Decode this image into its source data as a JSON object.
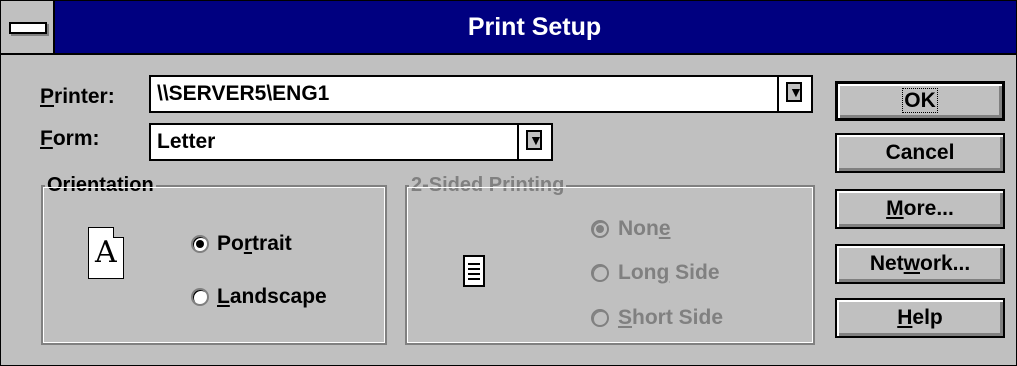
{
  "window": {
    "title": "Print Setup"
  },
  "printer": {
    "label_mnemonic": "P",
    "label_rest": "rinter:",
    "value": "\\\\SERVER5\\ENG1"
  },
  "form": {
    "label_mnemonic": "F",
    "label_rest": "orm:",
    "value": "Letter"
  },
  "orientation": {
    "title": "Orientation",
    "portrait": {
      "before": "Po",
      "mnemonic": "r",
      "after": "trait",
      "selected": true
    },
    "landscape": {
      "before": "",
      "mnemonic": "L",
      "after": "andscape",
      "selected": false
    },
    "icon_letter": "A"
  },
  "two_sided": {
    "title": "2-Sided Printing",
    "enabled": false,
    "none": {
      "before": "Non",
      "mnemonic": "e",
      "after": "",
      "selected": true
    },
    "long_side": {
      "before": "Lon",
      "mnemonic": "g",
      "after": " Side",
      "selected": false
    },
    "short_side": {
      "before": "",
      "mnemonic": "S",
      "after": "hort Side",
      "selected": false
    }
  },
  "buttons": {
    "ok": "OK",
    "cancel": "Cancel",
    "more": {
      "mnemonic": "M",
      "rest": "ore..."
    },
    "network": {
      "before": "Net",
      "mnemonic": "w",
      "after": "ork..."
    },
    "help": {
      "mnemonic": "H",
      "rest": "elp"
    }
  },
  "icons": {
    "system_menu": "system-menu-icon",
    "dropdown": "down-arrow-icon",
    "page": "portrait-page-icon",
    "document": "document-icon"
  }
}
